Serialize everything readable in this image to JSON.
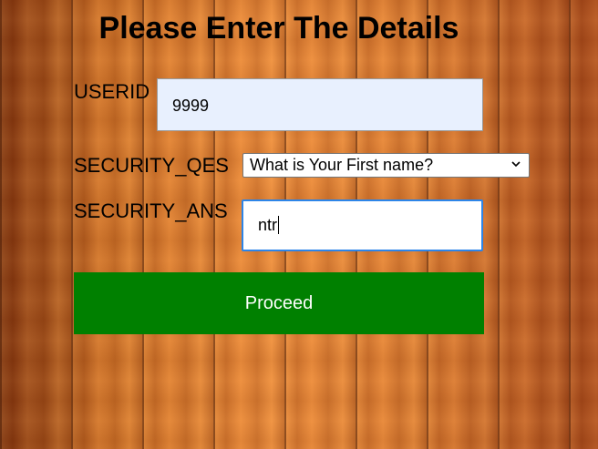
{
  "form": {
    "title": "Please Enter The Details",
    "userid_label": "USERID",
    "userid_value": "9999",
    "security_question_label": "SECURITY_QES",
    "security_question_selected": "What is Your First name?",
    "security_answer_label": "SECURITY_ANS",
    "security_answer_value": "ntr",
    "proceed_label": "Proceed"
  },
  "colors": {
    "proceed_button": "#008000",
    "autofill_background": "#e8f0fe",
    "focus_border": "#2d85e8"
  },
  "icons": {
    "select_arrow": "chevron-down-icon"
  }
}
